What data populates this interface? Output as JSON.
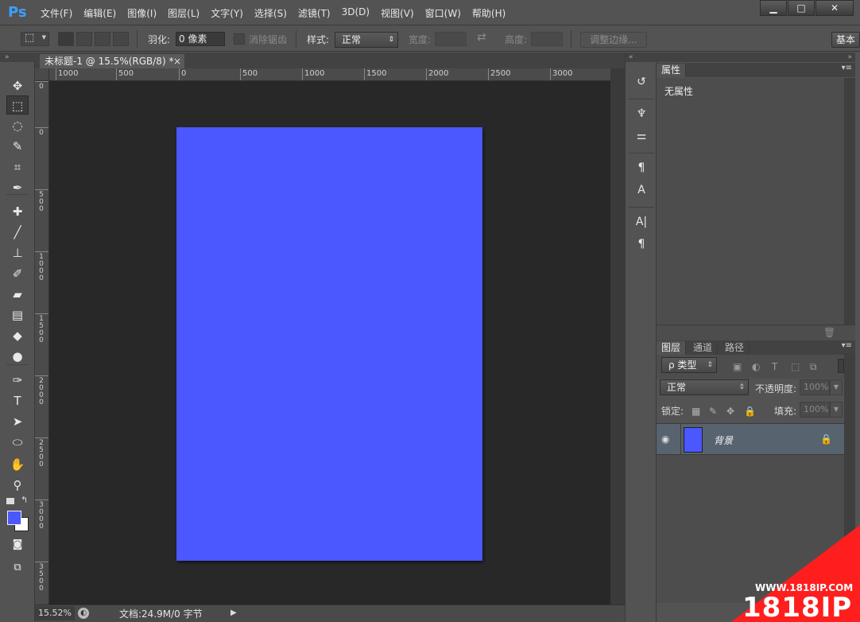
{
  "app": {
    "logo": "Ps"
  },
  "menu": [
    "文件(F)",
    "编辑(E)",
    "图像(I)",
    "图层(L)",
    "文字(Y)",
    "选择(S)",
    "滤镜(T)",
    "3D(D)",
    "视图(V)",
    "窗口(W)",
    "帮助(H)"
  ],
  "window_controls": {
    "minimize": "▁",
    "maximize": "□",
    "close": "✕"
  },
  "options": {
    "feather_label": "羽化:",
    "feather_value": "0 像素",
    "antialias_label": "消除锯齿",
    "style_label": "样式:",
    "style_value": "正常",
    "width_label": "宽度:",
    "height_label": "高度:",
    "refine_edge": "调整边缘...",
    "workspace": "基本"
  },
  "tools": [
    {
      "name": "move-tool",
      "glyph": "✥"
    },
    {
      "name": "marquee-tool",
      "glyph": "⬚"
    },
    {
      "name": "lasso-tool",
      "glyph": "◌"
    },
    {
      "name": "quick-selection-tool",
      "glyph": "✎"
    },
    {
      "name": "crop-tool",
      "glyph": "⌗"
    },
    {
      "name": "eyedropper-tool",
      "glyph": "✒"
    },
    {
      "name": "healing-brush-tool",
      "glyph": "✚"
    },
    {
      "name": "brush-tool",
      "glyph": "╱"
    },
    {
      "name": "clone-stamp-tool",
      "glyph": "⊥"
    },
    {
      "name": "history-brush-tool",
      "glyph": "✐"
    },
    {
      "name": "eraser-tool",
      "glyph": "▰"
    },
    {
      "name": "gradient-tool",
      "glyph": "▤"
    },
    {
      "name": "blur-tool",
      "glyph": "◆"
    },
    {
      "name": "dodge-tool",
      "glyph": "●"
    },
    {
      "name": "pen-tool",
      "glyph": "✑"
    },
    {
      "name": "type-tool",
      "glyph": "T"
    },
    {
      "name": "path-selection-tool",
      "glyph": "➤"
    },
    {
      "name": "shape-tool",
      "glyph": "⬭"
    },
    {
      "name": "hand-tool",
      "glyph": "✋"
    },
    {
      "name": "zoom-tool",
      "glyph": "⚲"
    }
  ],
  "colors": {
    "foreground": "#4b57ff",
    "background": "#ffffff",
    "canvas": "#4b57ff",
    "workspace": "#282828",
    "selected_layer": "#586370"
  },
  "document": {
    "tab_title": "未标题-1 @ 15.5%(RGB/8) *",
    "tab_close": "×",
    "zoom": "15.52%",
    "info": "文档:24.9M/0 字节",
    "status_arrow": "▶"
  },
  "ruler_h": [
    {
      "label": "1000",
      "at": 0
    },
    {
      "label": "500",
      "at": 1
    },
    {
      "label": "0",
      "at": 2
    },
    {
      "label": "500",
      "at": 3
    },
    {
      "label": "1000",
      "at": 4
    },
    {
      "label": "1500",
      "at": 5
    },
    {
      "label": "2000",
      "at": 6
    },
    {
      "label": "2500",
      "at": 7
    },
    {
      "label": "3000",
      "at": 8
    }
  ],
  "ruler_v": [
    "0",
    "0",
    "500",
    "1000",
    "1500",
    "2000",
    "2500",
    "3000",
    "3500"
  ],
  "dock": [
    "↺",
    "♆",
    "⚌",
    "¶",
    "A",
    "A|",
    "¶"
  ],
  "properties": {
    "tab": "属性",
    "title": "无属性",
    "menu": "▾≡"
  },
  "layers_panel": {
    "tabs": [
      "图层",
      "通道",
      "路径"
    ],
    "filter_label": "ρ 类型",
    "blend_mode": "正常",
    "opacity_label": "不透明度:",
    "opacity_value": "100%",
    "lock_label": "锁定:",
    "fill_label": "填充:",
    "fill_value": "100%",
    "layer_name": "背景"
  },
  "watermark": {
    "url": "WWW.1818IP.COM",
    "brand": "1818IP"
  }
}
